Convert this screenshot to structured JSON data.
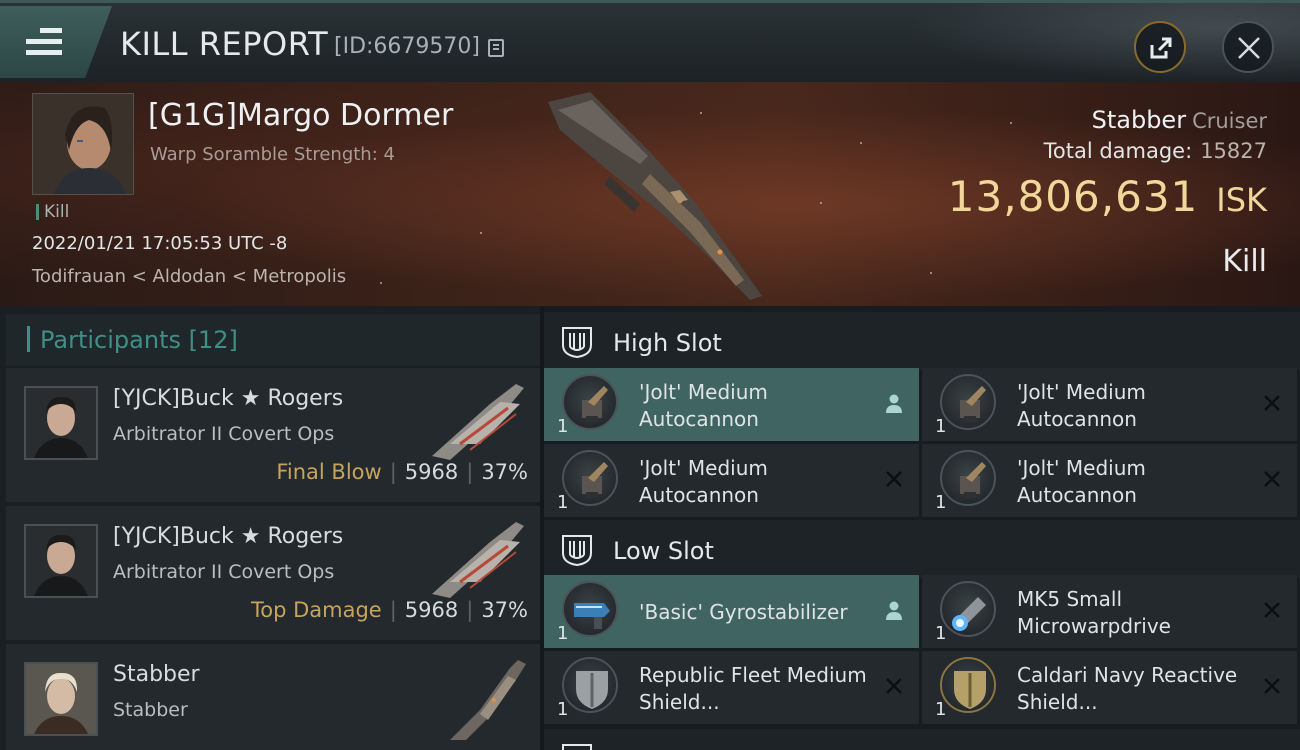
{
  "header": {
    "title": "KILL REPORT",
    "report_id": "[ID:6679570]"
  },
  "victim": {
    "name": "[G1G]Margo Dormer",
    "subtitle": "Warp Soramble Strength: 4",
    "tag": "Kill",
    "timestamp": "2022/01/21 17:05:53 UTC -8",
    "location": "Todifrauan < Aldodan < Metropolis",
    "ship_name": "Stabber",
    "ship_class": "Cruiser",
    "damage_label": "Total damage:",
    "damage_value": "15827",
    "isk_value": "13,806,631",
    "isk_unit": "ISK",
    "result": "Kill"
  },
  "participants": {
    "label": "Participants [12]",
    "items": [
      {
        "name": "[YJCK]Buck ★ Rogers",
        "ship": "Arbitrator II Covert Ops",
        "role": "Final Blow",
        "damage": "5968",
        "percent": "37%"
      },
      {
        "name": "[YJCK]Buck ★ Rogers",
        "ship": "Arbitrator II Covert Ops",
        "role": "Top Damage",
        "damage": "5968",
        "percent": "37%"
      },
      {
        "name": "Stabber",
        "ship": "Stabber",
        "role": "",
        "damage": "",
        "percent": ""
      }
    ]
  },
  "fitting": {
    "high_slot": {
      "label": "High Slot",
      "modules": [
        {
          "qty": "1",
          "name": "'Jolt' Medium Autocannon",
          "state": "fitted"
        },
        {
          "qty": "1",
          "name": "'Jolt' Medium Autocannon",
          "state": "destroyed"
        },
        {
          "qty": "1",
          "name": "'Jolt' Medium Autocannon",
          "state": "destroyed"
        },
        {
          "qty": "1",
          "name": "'Jolt' Medium Autocannon",
          "state": "destroyed"
        }
      ]
    },
    "low_slot": {
      "label": "Low Slot",
      "modules": [
        {
          "qty": "1",
          "name": "'Basic' Gyrostabilizer",
          "state": "fitted"
        },
        {
          "qty": "1",
          "name": "MK5 Small Microwarpdrive",
          "state": "destroyed"
        },
        {
          "qty": "1",
          "name": "Republic Fleet Medium Shield...",
          "state": "destroyed"
        },
        {
          "qty": "1",
          "name": "Caldari Navy Reactive Shield...",
          "state": "destroyed"
        }
      ]
    }
  },
  "colors": {
    "accent_teal": "#3f8f86",
    "highlight_row": "#3f6462",
    "isk_gold": "#f1d79a",
    "role_gold": "#c8a35c"
  },
  "icons": {
    "menu": "menu-icon",
    "copy": "copy-icon",
    "share": "share-icon",
    "close": "close-icon",
    "slot": "slot-icon",
    "fitted": "person-icon",
    "destroyed": "x-icon"
  }
}
